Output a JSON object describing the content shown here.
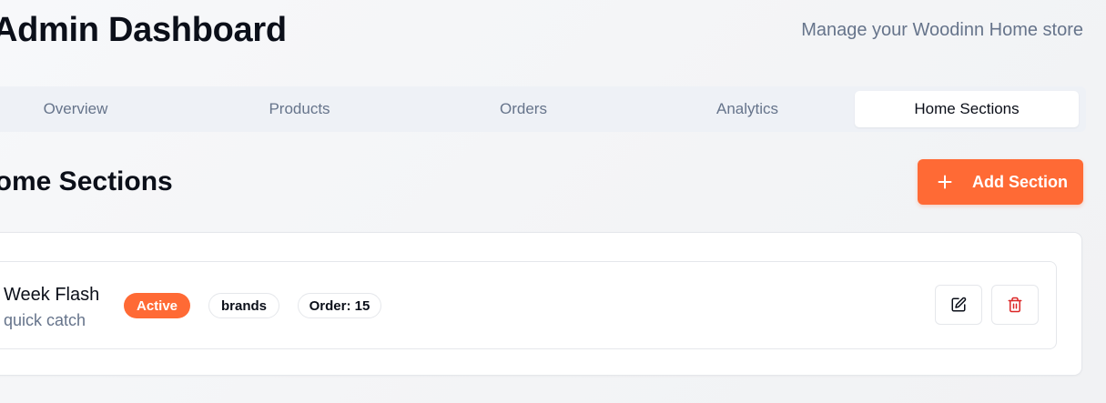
{
  "header": {
    "title": "Admin Dashboard",
    "subtitle": "Manage your Woodinn Home store"
  },
  "tabs": [
    {
      "label": "Overview",
      "active": false
    },
    {
      "label": "Products",
      "active": false
    },
    {
      "label": "Orders",
      "active": false
    },
    {
      "label": "Analytics",
      "active": false
    },
    {
      "label": "Home Sections",
      "active": true
    }
  ],
  "main": {
    "heading": "Home Sections",
    "add_button": {
      "label": "Add Section",
      "icon": "plus-icon"
    }
  },
  "sections": [
    {
      "title": "Week Flash",
      "description": "quick catch",
      "status": "Active",
      "type": "brands",
      "order": "Order: 15",
      "actions": {
        "edit_icon": "edit-icon",
        "delete_icon": "trash-icon"
      }
    }
  ],
  "colors": {
    "accent": "#ff6a35",
    "danger": "#dc2626",
    "muted_text": "#66748b",
    "tab_bar_bg": "#eef1f6",
    "border": "#e5e7eb"
  }
}
